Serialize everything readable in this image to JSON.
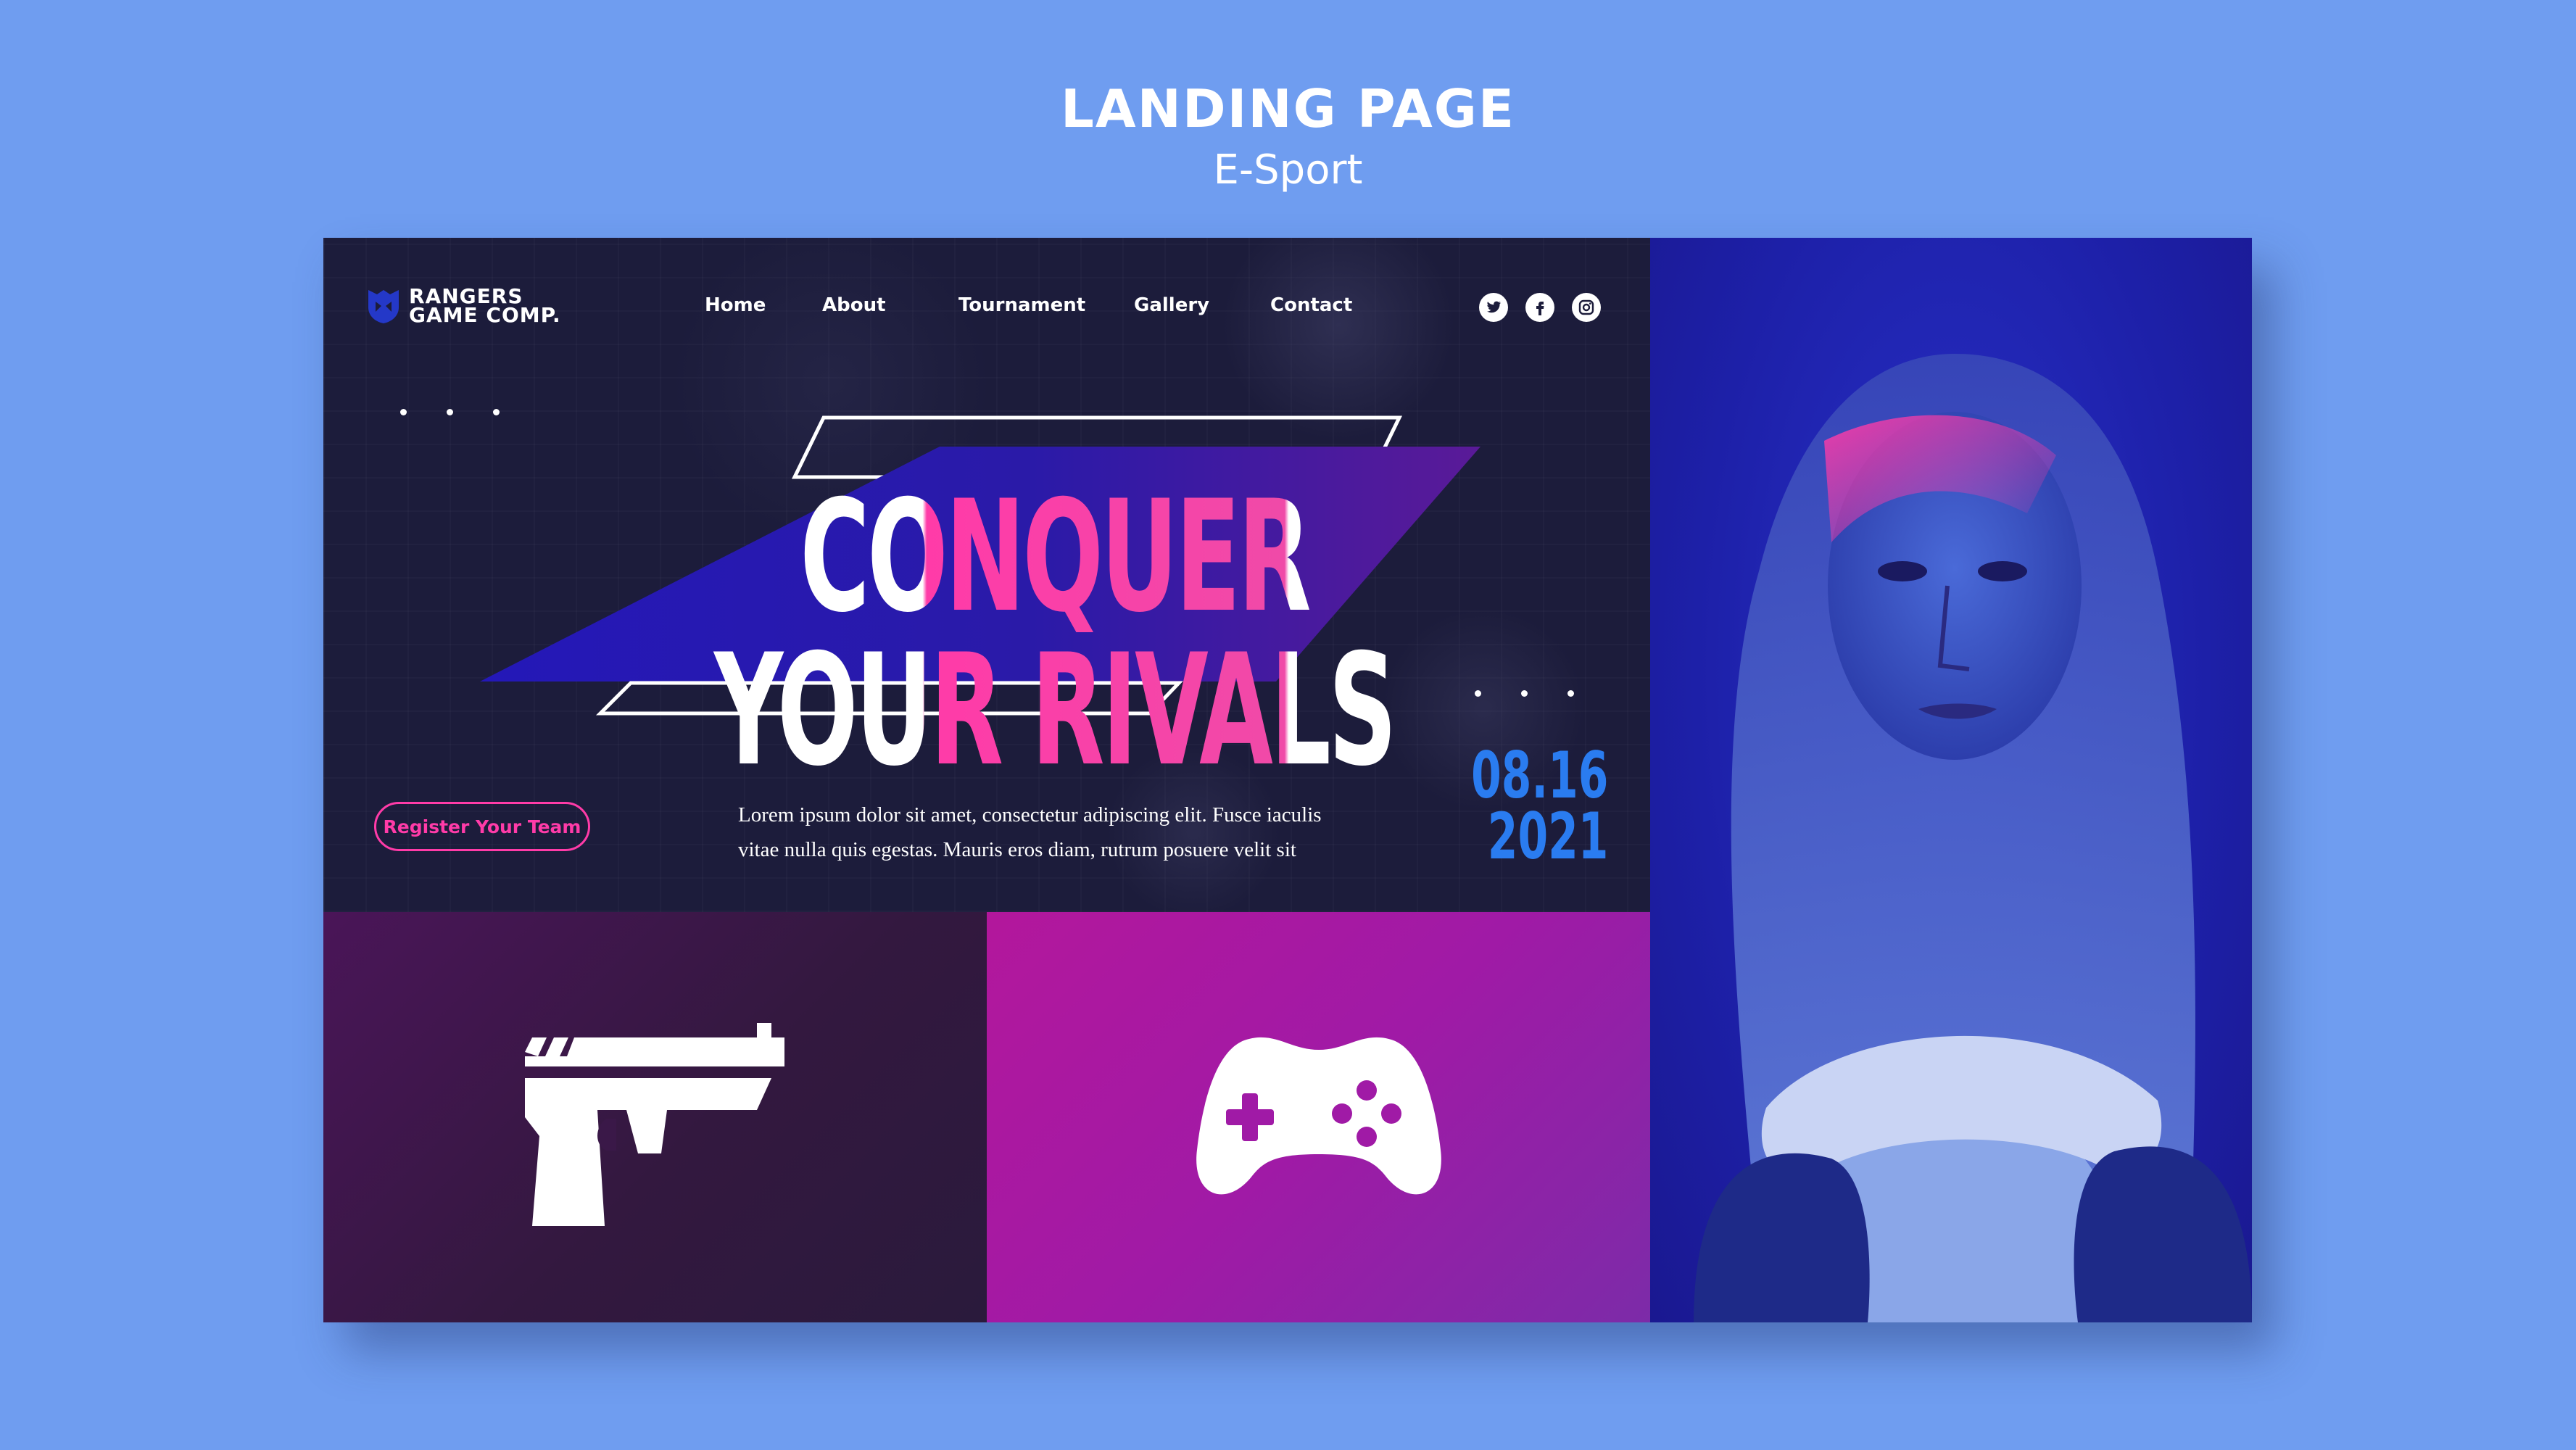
{
  "header": {
    "title": "LANDING PAGE",
    "subtitle": "E-Sport"
  },
  "logo": {
    "line1": "RANGERS",
    "line2": "GAME COMP.",
    "icon": "shield-logo-icon"
  },
  "nav": {
    "items": [
      "Home",
      "About",
      "Tournament",
      "Gallery",
      "Contact"
    ]
  },
  "social": [
    "twitter-icon",
    "facebook-icon",
    "instagram-icon"
  ],
  "hero": {
    "headline": "CONQUER YOUR RIVALS",
    "register_label": "Register Your Team",
    "body_line1": "Lorem ipsum dolor sit amet, consectetur adipiscing elit. Fusce iaculis",
    "body_line2": "vitae nulla quis egestas. Mauris eros diam, rutrum posuere velit sit",
    "date_line1": "08.16",
    "date_line2": "2021"
  },
  "tiles": [
    {
      "icon": "pistol-icon"
    },
    {
      "icon": "gamepad-icon"
    }
  ],
  "photo": {
    "subject": "woman-holding-controller-photo"
  },
  "colors": {
    "page_bg": "#6f9df0",
    "hero_bg": "#1c1c3b",
    "accent_pink": "#ff3ba8",
    "accent_blue": "#2a7cf0",
    "banner_blue": "#2b1ea8"
  }
}
